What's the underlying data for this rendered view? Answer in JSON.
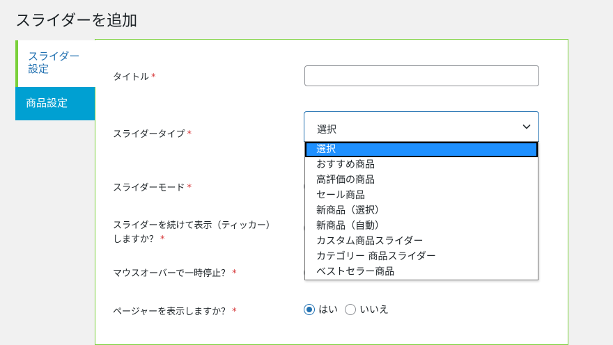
{
  "page": {
    "title": "スライダーを追加"
  },
  "tabs": [
    {
      "label_line1": "スライダー",
      "label_line2": "設定"
    },
    {
      "label": "商品設定"
    }
  ],
  "form": {
    "required_mark": "*",
    "fields": {
      "title_label": "タイトル",
      "title_value": "",
      "slider_type_label": "スライダータイプ",
      "slider_mode_label": "スライダーモード",
      "ticker_label_line1": "スライダーを続けて表示（ティッカー）",
      "ticker_label_line2": "しますか？",
      "pause_label": "マウスオーバーで一時停止？",
      "pager_label": "ページャーを表示しますか？"
    },
    "slider_type_select": {
      "selected": "選択",
      "options": [
        "選択",
        "おすすめ商品",
        "高評価の商品",
        "セール商品",
        "新商品（選択）",
        "新商品（自動）",
        "カスタム商品スライダー",
        "カテゴリー 商品スライダー",
        "ベストセラー商品"
      ]
    },
    "pager_radio": {
      "yes": "はい",
      "no": "いいえ",
      "checked": "yes"
    }
  },
  "icons": {
    "select_arrow": "chevron-down-icon"
  },
  "colors": {
    "accent_green": "#7ad03a",
    "tab_blue": "#00a0d2",
    "link_blue": "#2271b1",
    "option_highlight": "#1e90ff",
    "required_red": "#d63638"
  }
}
